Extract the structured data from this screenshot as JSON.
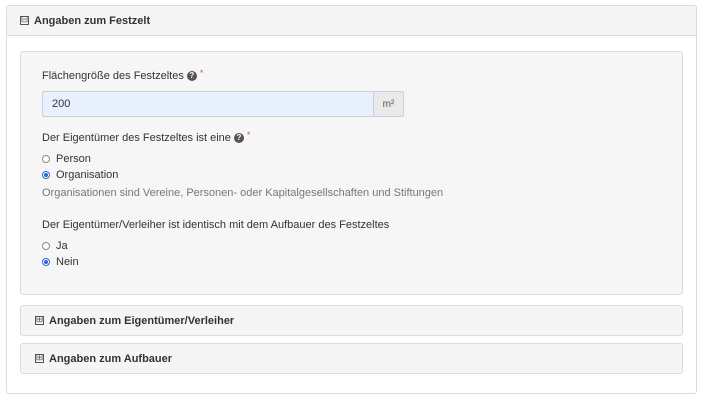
{
  "section_main": {
    "toggle": "⊟",
    "title": "Angaben zum Festzelt"
  },
  "area_field": {
    "label": "Flächengröße des Festzeltes",
    "help": "?",
    "required": "*",
    "value": "200",
    "unit": "m²"
  },
  "owner_type": {
    "label": "Der Eigentümer des Festzeltes ist eine",
    "help": "?",
    "required": "*",
    "options": [
      {
        "label": "Person",
        "checked": false
      },
      {
        "label": "Organisation",
        "checked": true
      }
    ],
    "hint": "Organisationen sind Vereine, Personen- oder Kapitalgesellschaften und Stiftungen"
  },
  "owner_identical": {
    "label": "Der Eigentümer/Verleiher ist identisch mit dem Aufbauer des Festzeltes",
    "options": [
      {
        "label": "Ja",
        "checked": false
      },
      {
        "label": "Nein",
        "checked": true
      }
    ]
  },
  "collapsed_sections": [
    {
      "toggle": "⊞",
      "title": "Angaben zum Eigentümer/Verleiher"
    },
    {
      "toggle": "⊞",
      "title": "Angaben zum Aufbauer"
    }
  ],
  "colors": {
    "accent": "#2a6ad2",
    "input_bg": "#e8f0fe",
    "required": "#d9534f"
  }
}
